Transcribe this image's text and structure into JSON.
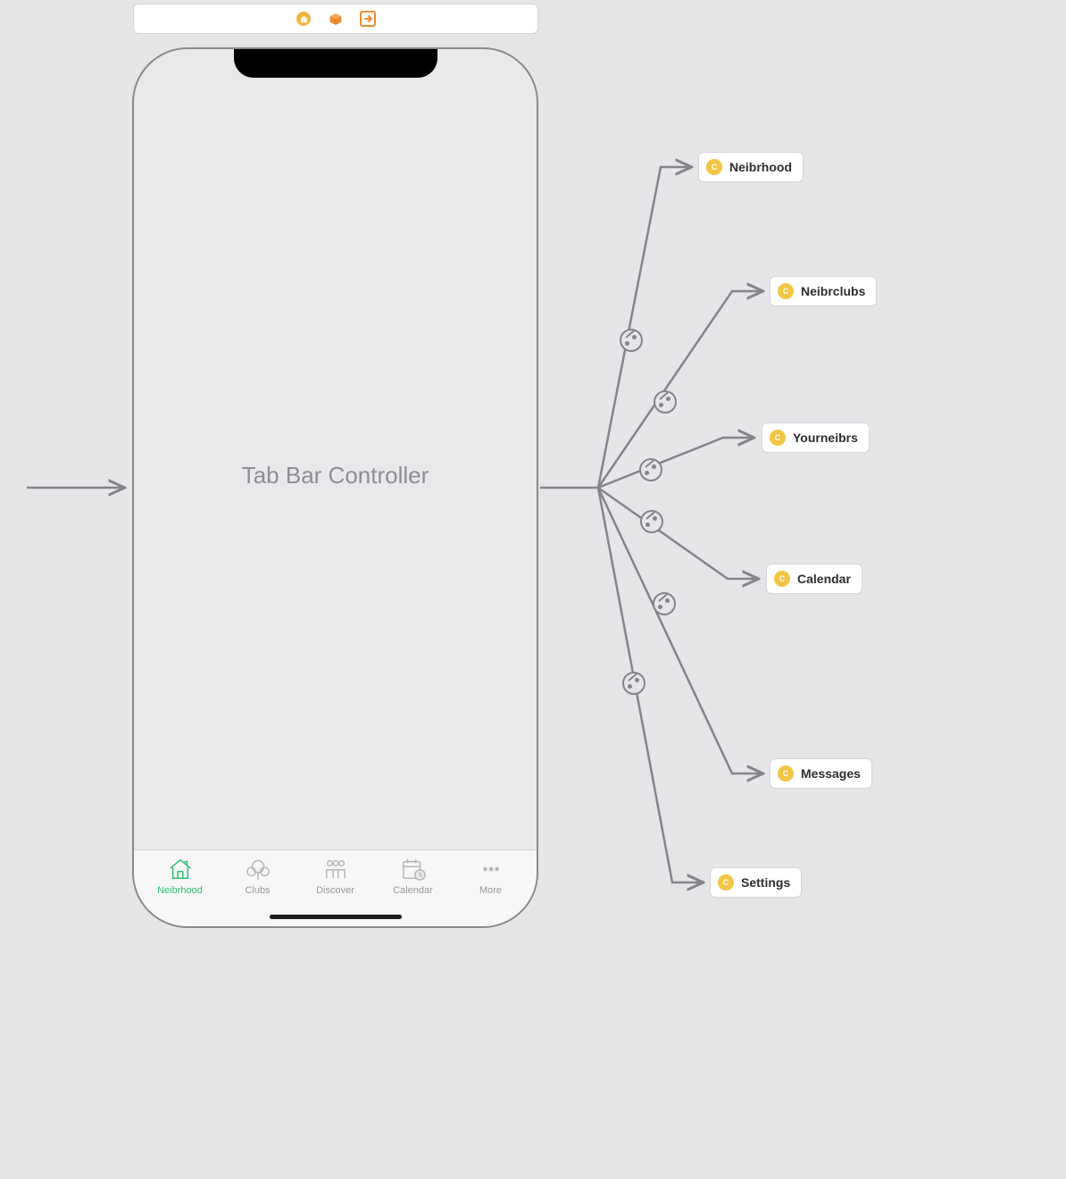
{
  "toolbar": {
    "icon1": "circle-icon",
    "icon2": "cube-icon",
    "icon3": "exit-icon"
  },
  "phone": {
    "title": "Tab Bar Controller"
  },
  "tabs": [
    {
      "label": "Neibrhood",
      "icon": "house-icon",
      "active": true
    },
    {
      "label": "Clubs",
      "icon": "clubs-icon",
      "active": false
    },
    {
      "label": "Discover",
      "icon": "people-icon",
      "active": false
    },
    {
      "label": "Calendar",
      "icon": "calendar-icon",
      "active": false
    },
    {
      "label": "More",
      "icon": "more-icon",
      "active": false
    }
  ],
  "destinations": [
    {
      "label": "Neibrhood",
      "icon": "C"
    },
    {
      "label": "Neibrclubs",
      "icon": "C"
    },
    {
      "label": "Yourneibrs",
      "icon": "C"
    },
    {
      "label": "Calendar",
      "icon": "C"
    },
    {
      "label": "Messages",
      "icon": "C"
    },
    {
      "label": "Settings",
      "icon": "C"
    }
  ],
  "colors": {
    "accent": "#2ebd6e",
    "inactive": "#9a9a9e",
    "chipIcon": "#f3c544",
    "toolbar1": "#f2b441",
    "toolbar2": "#ee8c30",
    "arrow": "#84858a"
  }
}
